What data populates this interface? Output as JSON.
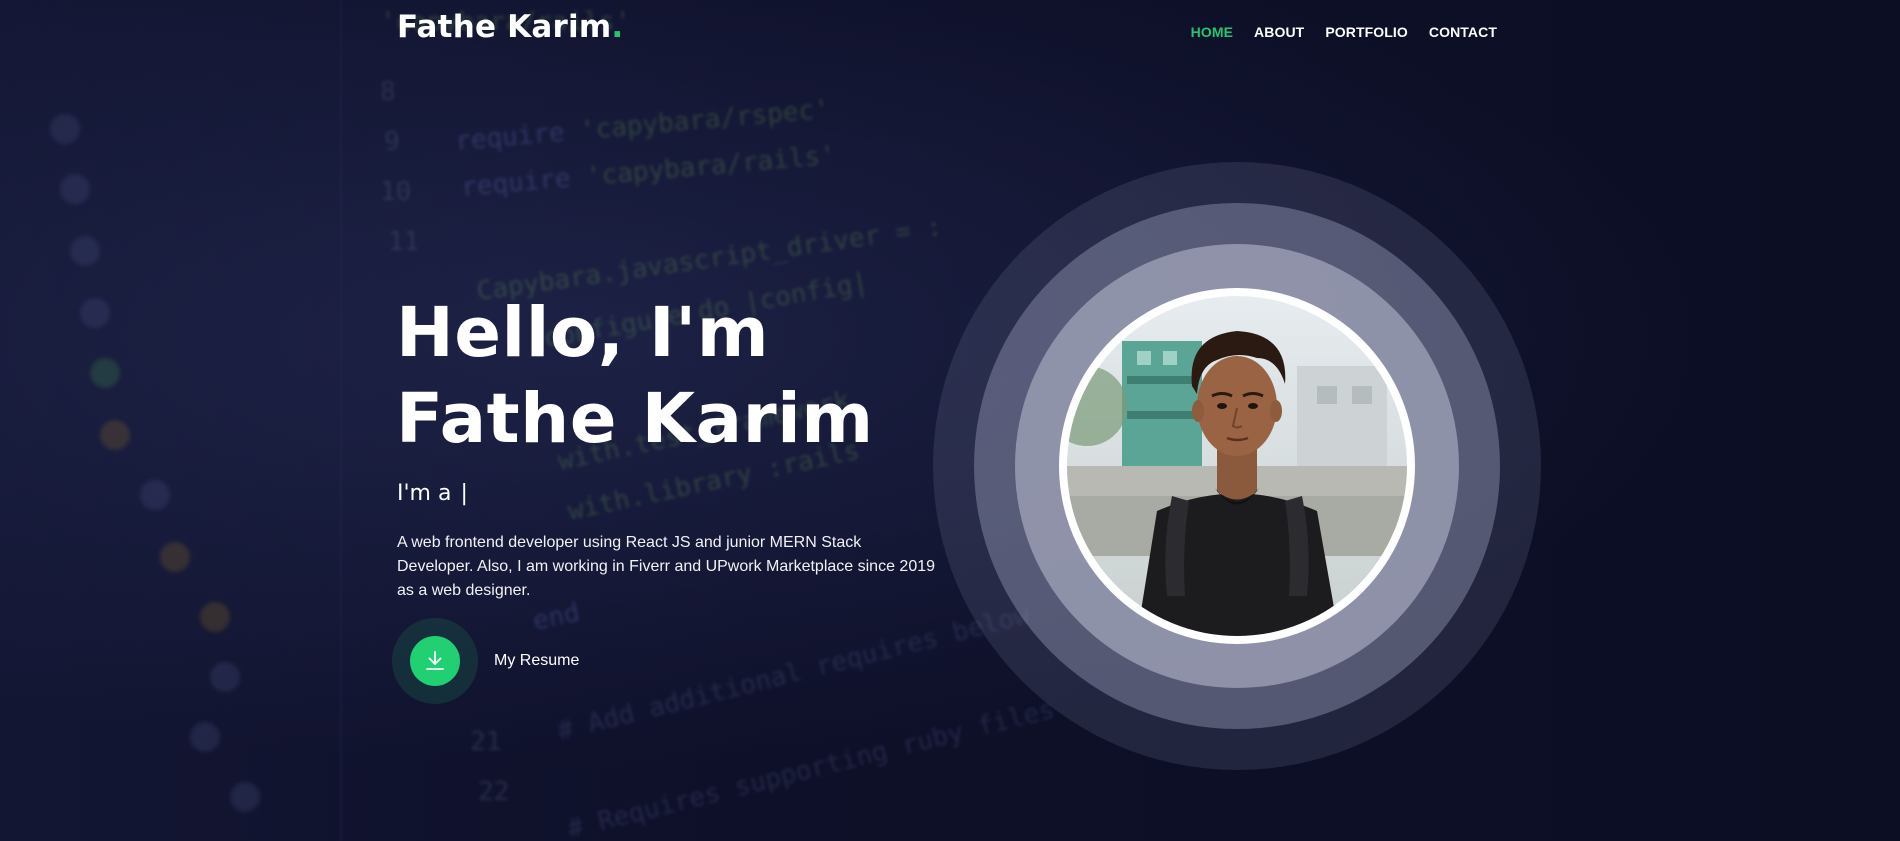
{
  "brand": {
    "name": "Fathe Karim",
    "dot": "."
  },
  "nav": {
    "items": [
      {
        "label": "HOME",
        "active": true
      },
      {
        "label": "ABOUT",
        "active": false
      },
      {
        "label": "PORTFOLIO",
        "active": false
      },
      {
        "label": "CONTACT",
        "active": false
      }
    ]
  },
  "hero": {
    "title_line_1": "Hello, I'm",
    "title_line_2": "Fathe Karim",
    "typing_prefix": "I'm a",
    "typing_cursor": "|",
    "description": "A web frontend developer using React JS and junior MERN Stack Developer. Also, I am working in Fiverr and UPwork Marketplace since 2019 as a web designer.",
    "resume_label": "My Resume",
    "resume_icon": "download-icon"
  },
  "portrait": {
    "icon": "profile-photo"
  },
  "colors": {
    "accent": "#22c870",
    "background": "#0d0f26",
    "text": "#ffffff"
  }
}
